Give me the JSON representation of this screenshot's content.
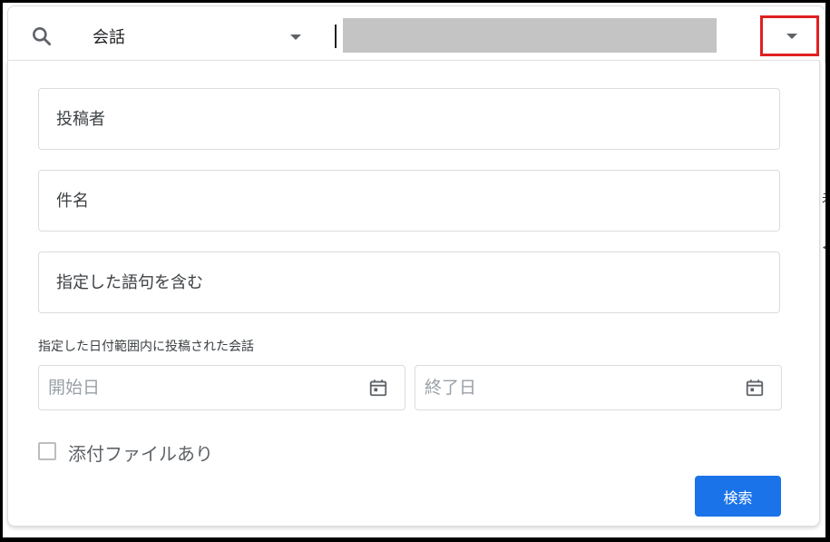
{
  "topbar": {
    "scope_label": "会話",
    "search_value": ""
  },
  "panel": {
    "fields": {
      "from_placeholder": "投稿者",
      "subject_placeholder": "件名",
      "has_words_placeholder": "指定した語句を含む"
    },
    "date_range": {
      "caption": "指定した日付範囲内に投稿された会話",
      "start_placeholder": "開始日",
      "end_placeholder": "終了日"
    },
    "attachment_label": "添付ファイルあり",
    "attachment_checked": false,
    "search_button_label": "検索"
  },
  "colors": {
    "highlight_box": "#e02020",
    "primary_button": "#1a73e8"
  },
  "icons": [
    "search-icon",
    "chevron-down-icon",
    "calendar-icon"
  ]
}
